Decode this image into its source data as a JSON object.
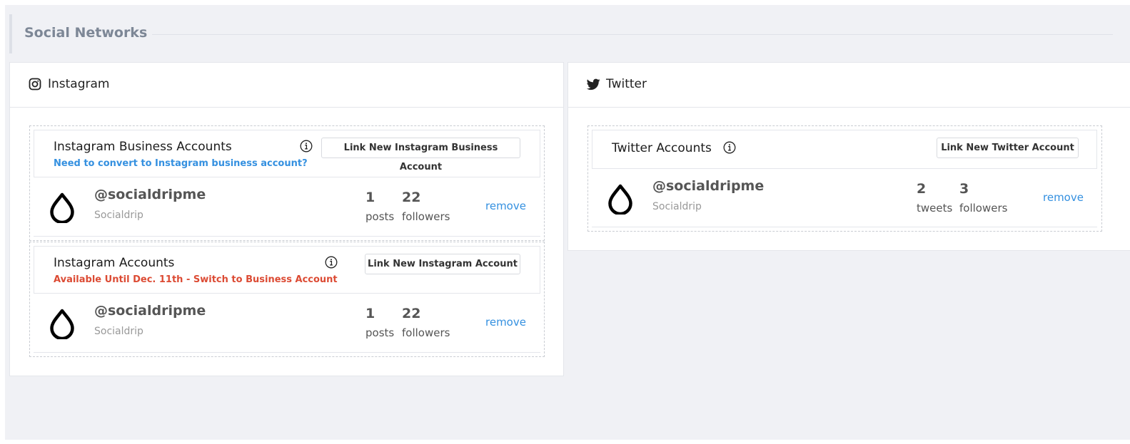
{
  "section": {
    "title": "Social Networks"
  },
  "instagram": {
    "panel_title": "Instagram",
    "business": {
      "title": "Instagram Business Accounts",
      "subtitle": "Need to convert to Instagram business account?",
      "button_label": "Link New Instagram Business Account",
      "account": {
        "handle": "@socialdripme",
        "name": "Socialdrip",
        "posts": "1",
        "posts_label": "posts",
        "followers": "22",
        "followers_label": "followers",
        "remove_label": "remove"
      }
    },
    "personal": {
      "title": "Instagram Accounts",
      "subtitle": "Available Until Dec. 11th - Switch to Business Account",
      "button_label": "Link New Instagram Account",
      "account": {
        "handle": "@socialdripme",
        "name": "Socialdrip",
        "posts": "1",
        "posts_label": "posts",
        "followers": "22",
        "followers_label": "followers",
        "remove_label": "remove"
      }
    }
  },
  "twitter": {
    "panel_title": "Twitter",
    "accounts": {
      "title": "Twitter Accounts",
      "button_label": "Link New Twitter Account",
      "account": {
        "handle": "@socialdripme",
        "name": "Socialdrip",
        "tweets": "2",
        "tweets_label": "tweets",
        "followers": "3",
        "followers_label": "followers",
        "remove_label": "remove"
      }
    }
  },
  "icons": {
    "instagram": "instagram-icon",
    "twitter": "twitter-bird-icon",
    "info": "info-circle-icon",
    "logo": "socialdrip-drop-logo"
  },
  "colors": {
    "page_bg": "#f0f1f5",
    "link_blue": "#3490e0",
    "warning_red": "#dc4b34",
    "heading_gray": "#7d8796"
  }
}
